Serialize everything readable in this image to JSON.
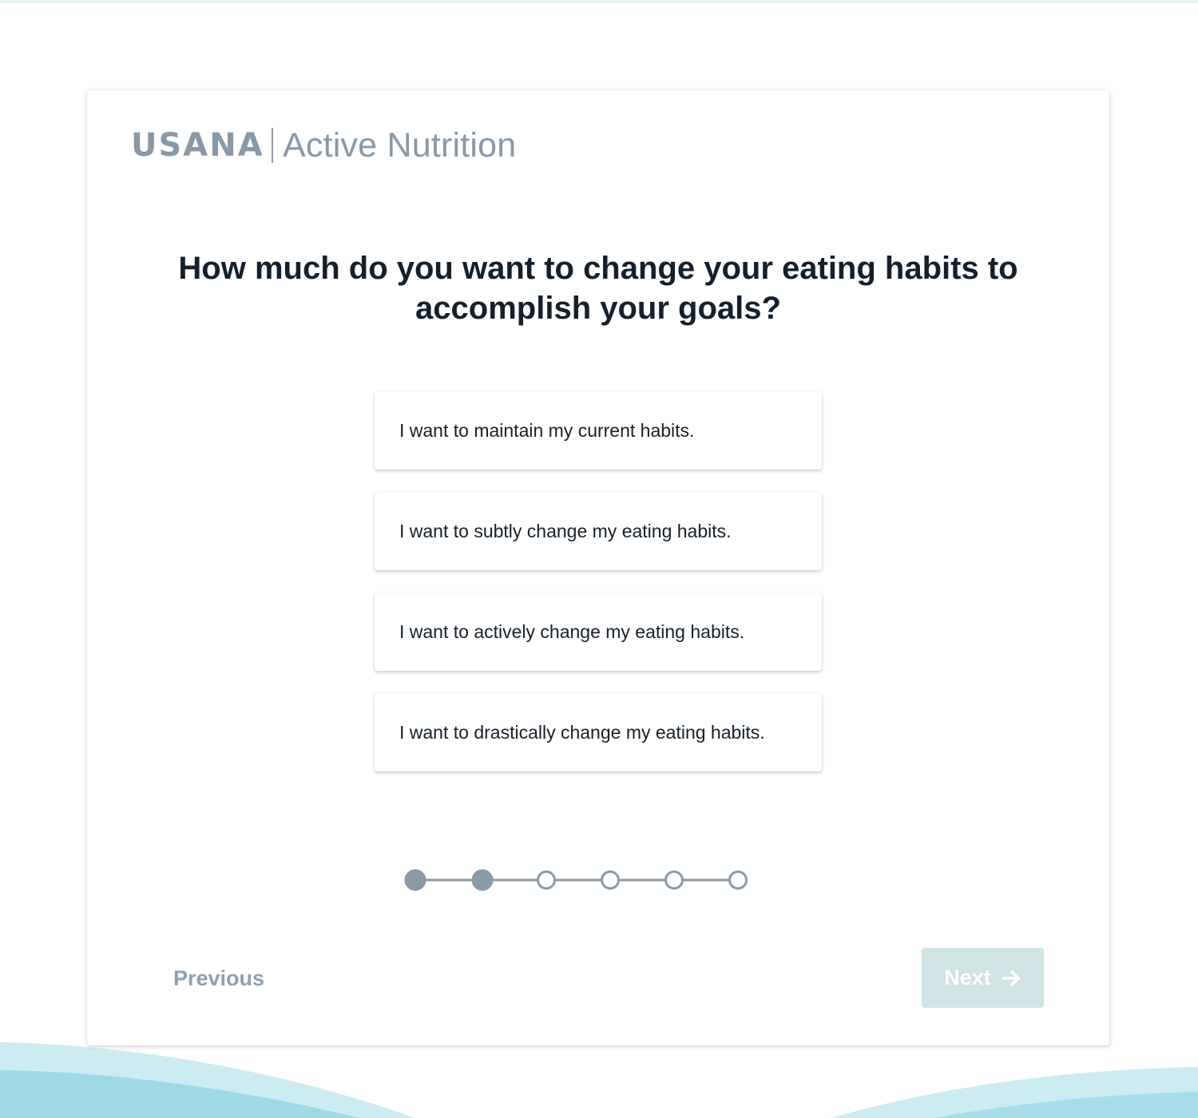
{
  "brand": {
    "logo_text": "USANA",
    "product_name": "Active Nutrition"
  },
  "question": {
    "line1": "How much do you want to change your eating habits to",
    "line2": "accomplish your goals?"
  },
  "options": [
    "I want to maintain my current habits.",
    "I want to subtly change my eating habits.",
    "I want to actively change my eating habits.",
    "I want to drastically change my eating habits."
  ],
  "progress": {
    "total_steps": 6,
    "completed_steps": 2
  },
  "navigation": {
    "previous_label": "Previous",
    "next_label": "Next"
  },
  "colors": {
    "accent_disabled": "#cfe4e4",
    "step_filled": "#8a9aa7",
    "wave": "#a6dde6",
    "text_dark": "#14202b"
  }
}
